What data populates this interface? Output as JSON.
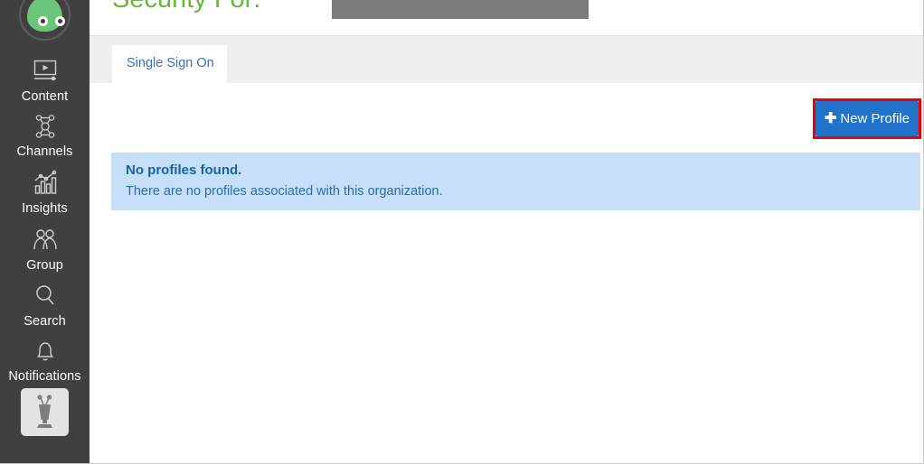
{
  "sidebar": {
    "avatar": {
      "icon": "robot-head-avatar",
      "color": "#6ac47a"
    },
    "items": [
      {
        "icon": "content-monitor-icon",
        "label": "Content"
      },
      {
        "icon": "channels-network-icon",
        "label": "Channels"
      },
      {
        "icon": "insights-bar-chart-icon",
        "label": "Insights"
      },
      {
        "icon": "group-people-icon",
        "label": "Group"
      },
      {
        "icon": "search-magnifier-icon",
        "label": "Search"
      },
      {
        "icon": "notifications-bell-icon",
        "label": "Notifications"
      }
    ],
    "account_tile": {
      "icon": "robot-figure-icon"
    }
  },
  "header": {
    "title": "Security For:",
    "title_color": "#6cb33f",
    "redaction": {
      "name": "redacted-organization-name"
    }
  },
  "tabs": [
    {
      "label": "Single Sign On",
      "active": true
    }
  ],
  "toolbar": {
    "new_profile_label": "New Profile",
    "plus_icon": "✚",
    "button_color": "#2172c9",
    "highlight_color": "#ee0000"
  },
  "alert": {
    "title": "No profiles found.",
    "body": "There are no profiles associated with this organization.",
    "background": "#c6e0fa",
    "text_color": "#2a6bb5"
  }
}
